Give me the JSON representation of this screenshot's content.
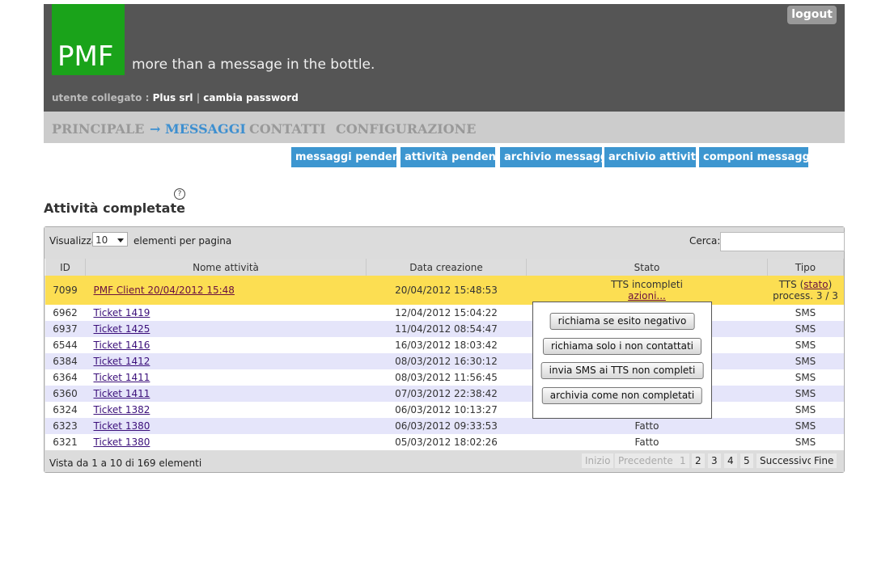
{
  "header": {
    "logo": "PMF",
    "tagline": "more than a message in the bottle.",
    "logout": "logout",
    "user_label": "utente collegato :",
    "user_name": "Plus srl",
    "separator": "|",
    "change_password": "cambia password"
  },
  "menu": [
    {
      "label": "PRINCIPALE"
    },
    {
      "label": "→ MESSAGGI"
    },
    {
      "label": "CONTATTI"
    },
    {
      "label": "CONFIGURAZIONE"
    }
  ],
  "submenu": [
    {
      "label": "messaggi pendenti"
    },
    {
      "label": "attività pendenti"
    },
    {
      "label": "archivio messaggi"
    },
    {
      "label": "archivio attività"
    },
    {
      "label": "componi messaggio"
    }
  ],
  "page_title": "Attività completate",
  "help_icon": "?",
  "table": {
    "length_label_before": "Visualizza",
    "length_value": "10",
    "length_label_after": "elementi per pagina",
    "search_label": "Cerca:",
    "search_value": "",
    "columns": [
      "ID",
      "Nome attività",
      "Data creazione",
      "Stato",
      "Tipo"
    ],
    "rows": [
      {
        "id": "7099",
        "name": "PMF Client 20/04/2012 15:48",
        "date": "20/04/2012 15:48:53",
        "stato": "TTS incompleti",
        "stato_link": "azioni...",
        "tipo_prefix": "TTS (",
        "tipo_link": "stato",
        "tipo_suffix": ")",
        "tipo_line2": "process. 3 / 3"
      },
      {
        "id": "6962",
        "name": "Ticket 1419",
        "date": "12/04/2012 15:04:22",
        "stato": "",
        "tipo": "SMS"
      },
      {
        "id": "6937",
        "name": "Ticket 1425",
        "date": "11/04/2012 08:54:47",
        "stato": "",
        "tipo": "SMS"
      },
      {
        "id": "6544",
        "name": "Ticket 1416",
        "date": "16/03/2012 18:03:42",
        "stato": "",
        "tipo": "SMS"
      },
      {
        "id": "6384",
        "name": "Ticket 1412",
        "date": "08/03/2012 16:30:12",
        "stato": "",
        "tipo": "SMS"
      },
      {
        "id": "6364",
        "name": "Ticket 1411",
        "date": "08/03/2012 11:56:45",
        "stato": "",
        "tipo": "SMS"
      },
      {
        "id": "6360",
        "name": "Ticket 1411",
        "date": "07/03/2012 22:38:42",
        "stato": "",
        "tipo": "SMS"
      },
      {
        "id": "6324",
        "name": "Ticket 1382",
        "date": "06/03/2012 10:13:27",
        "stato": "",
        "tipo": "SMS"
      },
      {
        "id": "6323",
        "name": "Ticket 1380",
        "date": "06/03/2012 09:33:53",
        "stato": "Fatto",
        "tipo": "SMS"
      },
      {
        "id": "6321",
        "name": "Ticket 1380",
        "date": "05/03/2012 18:02:26",
        "stato": "Fatto",
        "tipo": "SMS"
      }
    ],
    "info": "Vista da 1 a 10 di 169 elementi",
    "pagination": {
      "first": "Inizio",
      "previous": "Precedente",
      "pages": [
        "1",
        "2",
        "3",
        "4",
        "5"
      ],
      "next": "Successivo",
      "last": "Fine"
    }
  },
  "popup": {
    "buttons": [
      "richiama se esito negativo",
      "richiama solo i non contattati",
      "invia SMS ai TTS non completi",
      "archivia come non completati"
    ]
  }
}
